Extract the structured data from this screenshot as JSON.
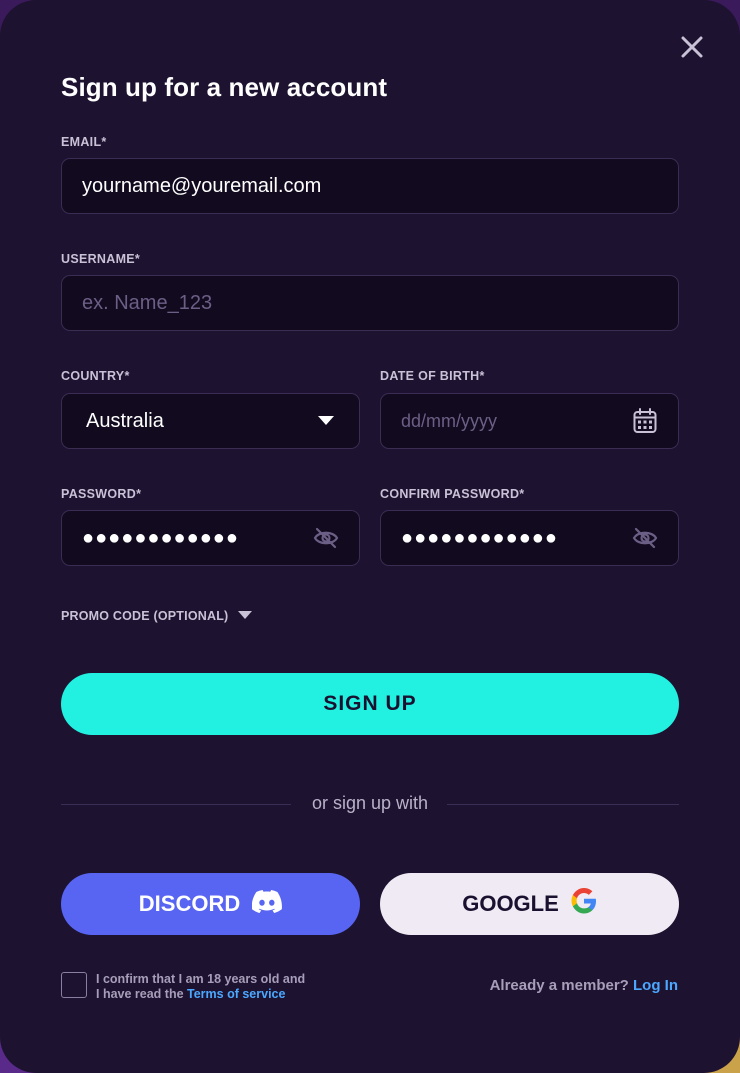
{
  "dialog": {
    "title": "Sign up for a new account",
    "close_icon": "close-icon"
  },
  "form": {
    "email": {
      "label": "EMAIL*",
      "value": "yourname@youremail.com"
    },
    "username": {
      "label": "USERNAME*",
      "placeholder": "ex. Name_123"
    },
    "country": {
      "label": "COUNTRY*",
      "selected": "Australia",
      "icon": "caret-down-icon"
    },
    "dob": {
      "label": "DATE OF BIRTH*",
      "placeholder": "dd/mm/yyyy",
      "icon": "calendar-icon"
    },
    "password": {
      "label": "PASSWORD*",
      "masked": "●●●●●●●●●●●●",
      "icon": "eye-off-icon"
    },
    "confirm_password": {
      "label": "CONFIRM PASSWORD*",
      "masked": "●●●●●●●●●●●●",
      "icon": "eye-off-icon"
    },
    "promo": {
      "label": "PROMO CODE (OPTIONAL)",
      "icon": "caret-down-icon"
    }
  },
  "actions": {
    "signup_label": "SIGN UP",
    "divider_text": "or sign up with",
    "discord_label": "DISCORD",
    "google_label": "GOOGLE"
  },
  "footer": {
    "confirm_line1": "I confirm that I am 18 years old and",
    "confirm_line2_prefix": "I have read the ",
    "terms_link": "Terms of service",
    "member_prefix": "Already a member? ",
    "login_link": "Log In"
  },
  "colors": {
    "background": "#1e1231",
    "field_bg": "#120a1f",
    "accent": "#22f0e0",
    "discord": "#5865f2",
    "google_bg": "#efeaf3",
    "link": "#4aa8ff"
  }
}
